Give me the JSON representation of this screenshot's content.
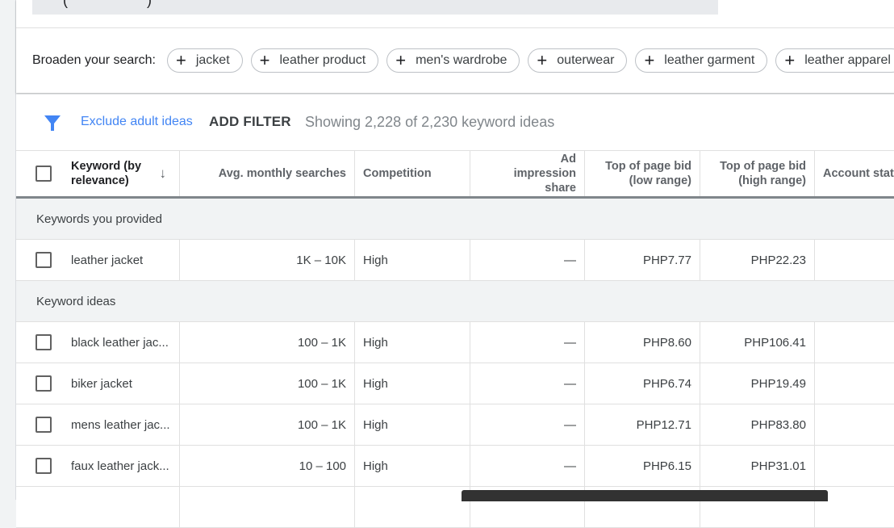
{
  "search": {
    "glyphs": [
      "(",
      ")"
    ]
  },
  "broaden": {
    "label": "Broaden your search:",
    "chips": [
      "jacket",
      "leather product",
      "men's wardrobe",
      "outerwear",
      "leather garment",
      "leather apparel"
    ]
  },
  "filter_bar": {
    "icon": "filter-icon",
    "exclude_label": "Exclude adult ideas",
    "add_filter_label": "ADD FILTER",
    "showing_text": "Showing 2,228 of 2,230 keyword ideas",
    "accent_color": "#4285f4"
  },
  "table": {
    "headers": {
      "keyword": "Keyword (by relevance)",
      "avg_monthly": "Avg. monthly searches",
      "competition": "Competition",
      "ad_impression": "Ad impression share",
      "bid_low": "Top of page bid (low range)",
      "bid_high": "Top of page bid (high range)",
      "account_status": "Account status"
    },
    "sort_icon": "arrow-down-icon",
    "groups": {
      "provided": "Keywords you provided",
      "ideas": "Keyword ideas"
    },
    "provided_rows": [
      {
        "keyword": "leather jacket",
        "avg": "1K – 10K",
        "competition": "High",
        "impression": "—",
        "low": "PHP7.77",
        "high": "PHP22.23",
        "status": ""
      }
    ],
    "idea_rows": [
      {
        "keyword": "black leather jac...",
        "avg": "100 – 1K",
        "competition": "High",
        "impression": "—",
        "low": "PHP8.60",
        "high": "PHP106.41",
        "status": ""
      },
      {
        "keyword": "biker jacket",
        "avg": "100 – 1K",
        "competition": "High",
        "impression": "—",
        "low": "PHP6.74",
        "high": "PHP19.49",
        "status": ""
      },
      {
        "keyword": "mens leather jac...",
        "avg": "100 – 1K",
        "competition": "High",
        "impression": "—",
        "low": "PHP12.71",
        "high": "PHP83.80",
        "status": ""
      },
      {
        "keyword": "faux leather jack...",
        "avg": "10 – 100",
        "competition": "High",
        "impression": "—",
        "low": "PHP6.15",
        "high": "PHP31.01",
        "status": ""
      }
    ]
  }
}
